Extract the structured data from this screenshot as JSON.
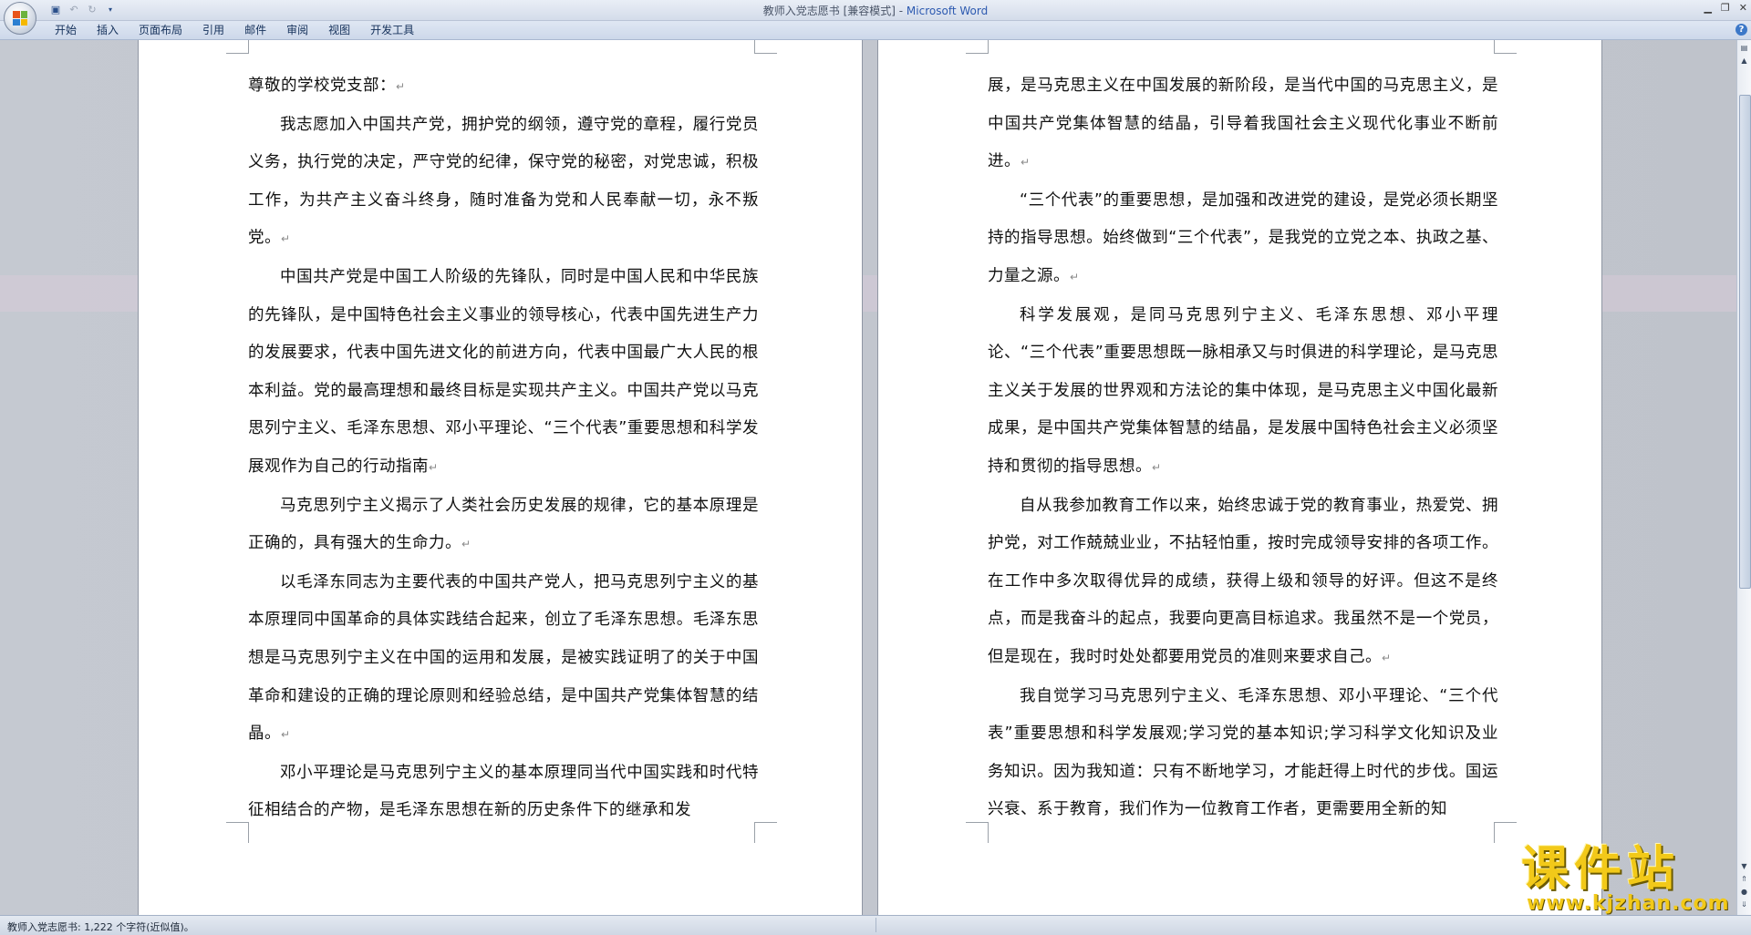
{
  "window": {
    "doc_title": "教师入党志愿书 [兼容模式] - ",
    "app_name": "Microsoft Word"
  },
  "ribbon": {
    "tabs": [
      "开始",
      "插入",
      "页面布局",
      "引用",
      "邮件",
      "审阅",
      "视图",
      "开发工具"
    ]
  },
  "page1": {
    "paragraphs": [
      "尊敬的学校党支部：",
      "我志愿加入中国共产党，拥护党的纲领，遵守党的章程，履行党员义务，执行党的决定，严守党的纪律，保守党的秘密，对党忠诚，积极工作，为共产主义奋斗终身，随时准备为党和人民奉献一切，永不叛党。",
      "中国共产党是中国工人阶级的先锋队，同时是中国人民和中华民族的先锋队，是中国特色社会主义事业的领导核心，代表中国先进生产力的发展要求，代表中国先进文化的前进方向，代表中国最广大人民的根本利益。党的最高理想和最终目标是实现共产主义。中国共产党以马克思列宁主义、毛泽东思想、邓小平理论、“三个代表”重要思想和科学发展观作为自己的行动指南",
      "马克思列宁主义揭示了人类社会历史发展的规律，它的基本原理是正确的，具有强大的生命力。",
      "以毛泽东同志为主要代表的中国共产党人，把马克思列宁主义的基本原理同中国革命的具体实践结合起来，创立了毛泽东思想。毛泽东思想是马克思列宁主义在中国的运用和发展，是被实践证明了的关于中国革命和建设的正确的理论原则和经验总结，是中国共产党集体智慧的结晶。",
      "邓小平理论是马克思列宁主义的基本原理同当代中国实践和时代特征相结合的产物，是毛泽东思想在新的历史条件下的继承和发"
    ]
  },
  "page2": {
    "paragraphs": [
      "展，是马克思主义在中国发展的新阶段，是当代中国的马克思主义，是中国共产党集体智慧的结晶，引导着我国社会主义现代化事业不断前进。",
      "“三个代表”的重要思想，是加强和改进党的建设，是党必须长期坚持的指导思想。始终做到“三个代表”，是我党的立党之本、执政之基、力量之源。",
      "科学发展观，是同马克思列宁主义、毛泽东思想、邓小平理论、“三个代表”重要思想既一脉相承又与时俱进的科学理论，是马克思主义关于发展的世界观和方法论的集中体现，是马克思主义中国化最新成果，是中国共产党集体智慧的结晶，是发展中国特色社会主义必须坚持和贯彻的指导思想。",
      "自从我参加教育工作以来，始终忠诚于党的教育事业，热爱党、拥护党，对工作兢兢业业，不拈轻怕重，按时完成领导安排的各项工作。在工作中多次取得优异的成绩，获得上级和领导的好评。但这不是终点，而是我奋斗的起点，我要向更高目标追求。我虽然不是一个党员，但是现在，我时时处处都要用党员的准则来要求自己。",
      "我自觉学习马克思列宁主义、毛泽东思想、邓小平理论、“三个代表”重要思想和科学发展观;学习党的基本知识;学习科学文化知识及业务知识。因为我知道：只有不断地学习，才能赶得上时代的步伐。国运兴衰、系于教育，我们作为一位教育工作者，更需要用全新的知"
    ]
  },
  "paragraph_mark": "↵",
  "status": {
    "text": "教师入党志愿书: 1,222 个字符(近似值)。"
  },
  "watermark": {
    "big": "课件站",
    "small": "www.kjzhan.com"
  }
}
